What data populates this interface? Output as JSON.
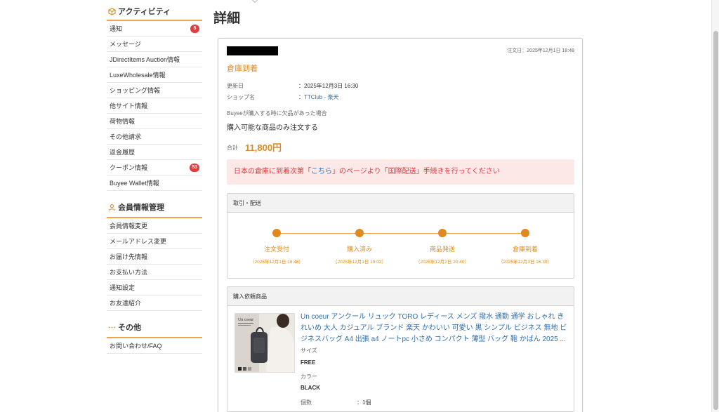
{
  "sidebar": {
    "activity": {
      "title": "アクティビティ",
      "icon": "box-icon",
      "items": [
        {
          "label": "通知",
          "badge": "5"
        },
        {
          "label": "メッセージ"
        },
        {
          "label": "JDirectItems Auction情報"
        },
        {
          "label": "LuxeWholesale情報"
        },
        {
          "label": "ショッピング情報"
        },
        {
          "label": "他サイト情報"
        },
        {
          "label": "荷物情報"
        },
        {
          "label": "その他請求"
        },
        {
          "label": "返金履歴"
        },
        {
          "label": "クーポン情報",
          "badge": "53"
        },
        {
          "label": "Buyee Wallet情報"
        }
      ]
    },
    "member": {
      "title": "会員情報管理",
      "icon": "user-icon",
      "items": [
        {
          "label": "会員情報変更"
        },
        {
          "label": "メールアドレス変更"
        },
        {
          "label": "お届け先情報"
        },
        {
          "label": "お支払い方法"
        },
        {
          "label": "通知設定"
        },
        {
          "label": "お友達紹介"
        }
      ]
    },
    "other": {
      "title": "その他",
      "icon": "more-dots-icon",
      "items": [
        {
          "label": "お問い合わせ/FAQ"
        }
      ]
    }
  },
  "main": {
    "page_title": "詳細",
    "order_date": "注文日：2025年12月1日 18:48",
    "status": "倉庫到着",
    "updated_label": "更新日",
    "updated_value": "：2025年12月3日 16:30",
    "shop_label": "ショップ名",
    "shop_prefix": "：",
    "shop_value": "TTClub - 楽天",
    "note_label": "Buyeeが購入する時に欠品があった場合",
    "note_value": "購入可能な商品のみ注文する",
    "total_label": "合計",
    "total_value": "11,800円",
    "alert": {
      "before": "日本の倉庫に到着次第「",
      "link": "こちら",
      "after": "」のページより「国際配送」手続きを行ってください"
    },
    "shipping_panel": {
      "title": "取引・配送",
      "steps": [
        {
          "label": "注文受付",
          "date": "（2025年12月1日 18:48）"
        },
        {
          "label": "購入済み",
          "date": "（2025年12月1日 19:02）"
        },
        {
          "label": "商品発送",
          "date": "（2025年12月2日 20:40）"
        },
        {
          "label": "倉庫到着",
          "date": "（2025年12月3日 16:30）"
        }
      ]
    },
    "items_panel": {
      "title": "購入依頼商品",
      "item": {
        "title": "Un coeur アンクール リュック TORO レディース メンズ 撥水 通勤 通学 おしゃれ きれいめ 大人 カジュアル ブランド 楽天 かわいい 可愛い 黒 シンプル ビジネス 無地 ビジネスバッグ A4 出張 a4 ノートpc 小さめ コンパクト 薄型 バッグ 鞄 かばん 2025 ...",
        "thumb_text": "Un coeur",
        "size_label": "サイズ",
        "size_value": "FREE",
        "color_label": "カラー",
        "color_value": "BLACK",
        "qty_label": "個数",
        "qty_value": "：1個"
      }
    }
  },
  "colors": {
    "accent": "#e08a1e",
    "alert_bg": "#fde8e8",
    "alert_text": "#d93a3a",
    "link": "#2a6fb5",
    "badge": "#e23b3b"
  }
}
